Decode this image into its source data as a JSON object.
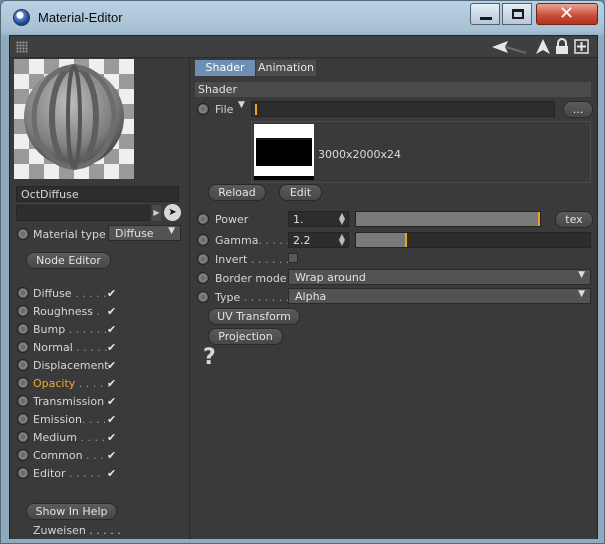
{
  "window": {
    "title": "Material-Editor"
  },
  "material": {
    "name": "OctDiffuse"
  },
  "material_type": {
    "label": "Material type",
    "value": "Diffuse"
  },
  "node_editor_label": "Node Editor",
  "channels": [
    {
      "label": "Diffuse",
      "dots": " . . . . .",
      "checked": true,
      "active": false
    },
    {
      "label": "Roughness",
      "dots": " .",
      "checked": true,
      "active": false
    },
    {
      "label": "Bump",
      "dots": " . . . . . .",
      "checked": true,
      "active": false
    },
    {
      "label": "Normal",
      "dots": " . . . . .",
      "checked": true,
      "active": false
    },
    {
      "label": "Displacement",
      "dots": "",
      "checked": true,
      "active": false
    },
    {
      "label": "Opacity",
      "dots": " . . . . .",
      "checked": true,
      "active": true
    },
    {
      "label": "Transmission",
      "dots": "",
      "checked": true,
      "active": false
    },
    {
      "label": "Emission",
      "dots": ". . . .",
      "checked": true,
      "active": false
    },
    {
      "label": "Medium",
      "dots": " . . . .",
      "checked": true,
      "active": false
    },
    {
      "label": "Common",
      "dots": " . . .",
      "checked": true,
      "active": false
    },
    {
      "label": "Editor",
      "dots": " . . . . .",
      "checked": true,
      "active": false
    }
  ],
  "show_in_help_label": "Show In Help",
  "zuweisen_label": "Zuweisen . . . . .",
  "tabs": [
    {
      "label": "Shader",
      "selected": true
    },
    {
      "label": "Animation",
      "selected": false
    }
  ],
  "section_title": "Shader",
  "file": {
    "label": "File",
    "value": "",
    "browse_label": "..."
  },
  "texture": {
    "info": "3000x2000x24"
  },
  "reload_label": "Reload",
  "edit_label": "Edit",
  "power": {
    "label": "Power",
    "value": "1.",
    "slider_fraction": 1.0,
    "tex_label": "tex"
  },
  "gamma": {
    "label": "Gamma",
    "dots": ". . . . .",
    "value": "2.2",
    "slider_fraction": 0.22
  },
  "invert": {
    "label": "Invert",
    "dots": " . . . . . . .",
    "checked": false
  },
  "border_mode": {
    "label": "Border mode",
    "value": "Wrap around"
  },
  "type": {
    "label": "Type",
    "dots": " . . . . . . .",
    "value": "Alpha"
  },
  "uv_transform_label": "UV Transform",
  "projection_label": "Projection",
  "help_icon": "question-mark-icon",
  "colors": {
    "accent": "#f0a020",
    "tab_selected": "#6e8fb3",
    "close_button": "#c94a33"
  }
}
